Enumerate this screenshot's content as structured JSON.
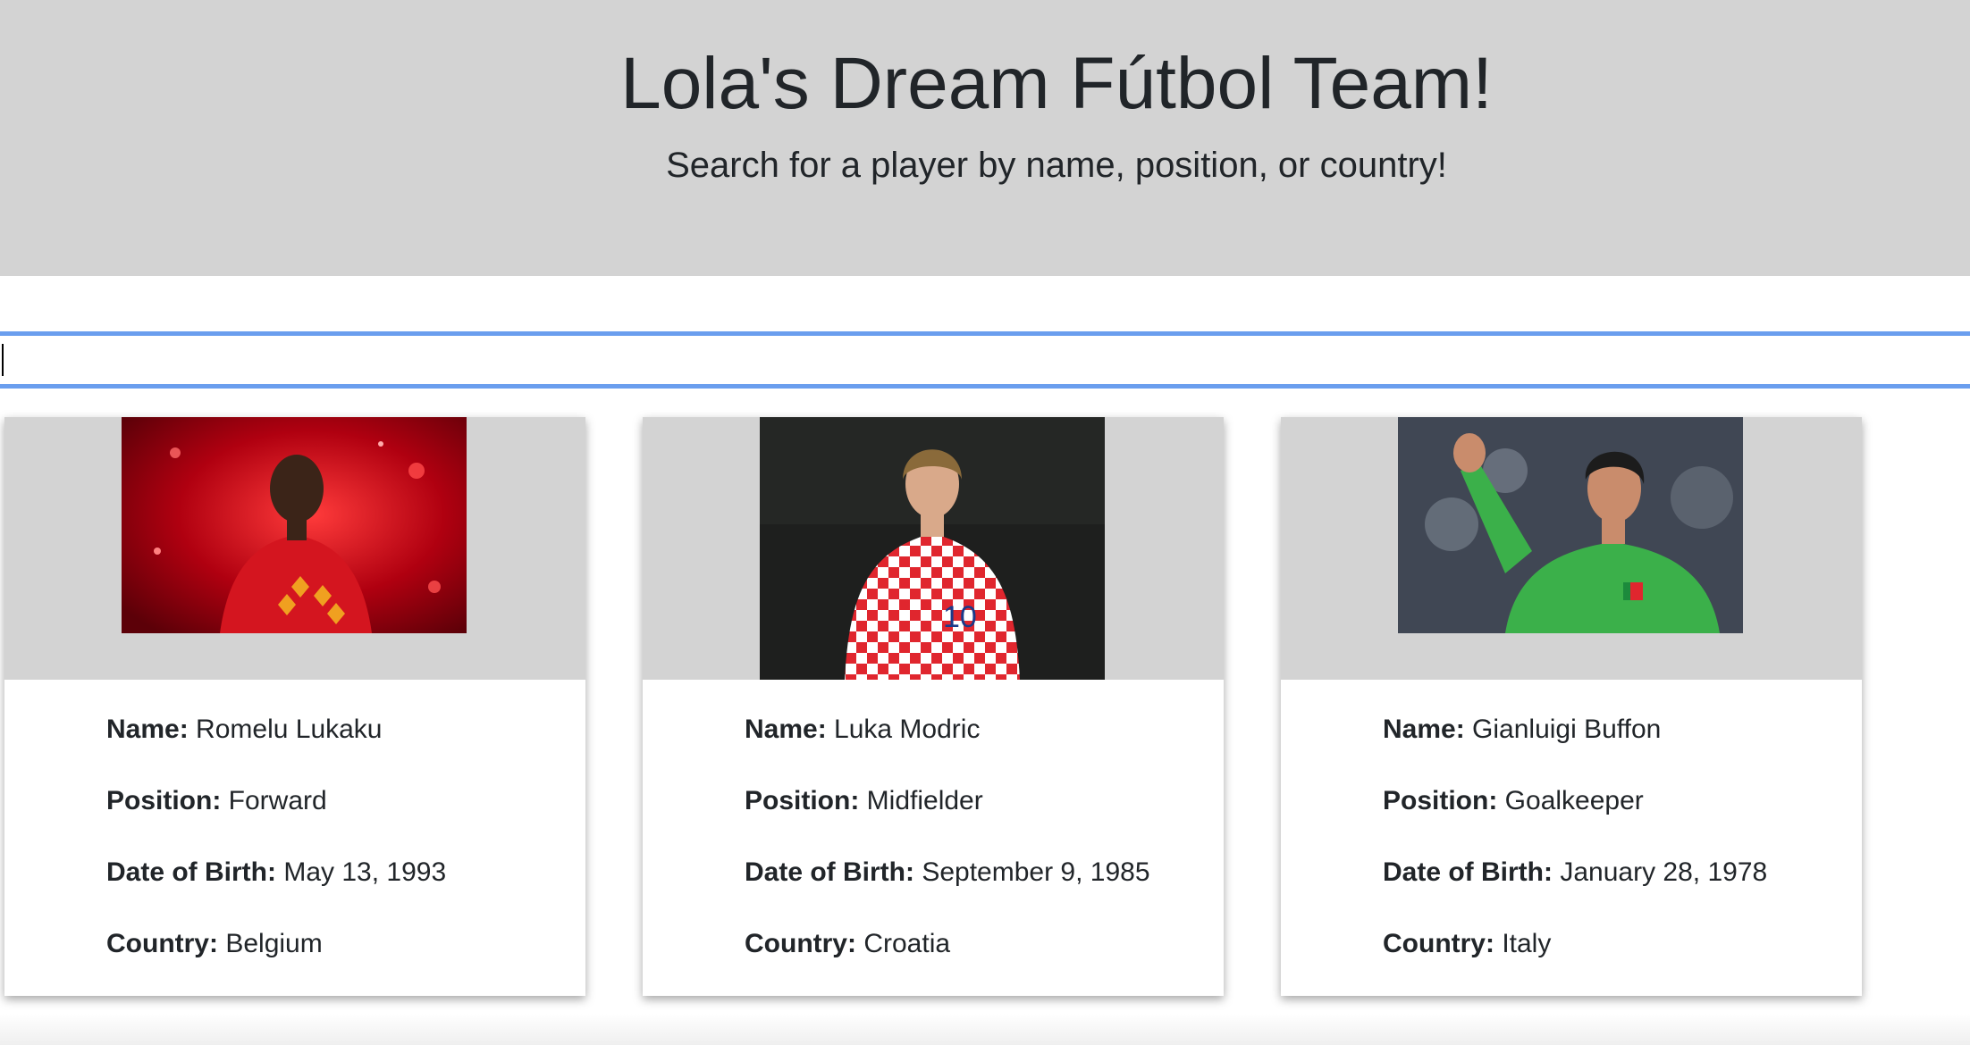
{
  "header": {
    "title": "Lola's Dream Fútbol Team!",
    "subtitle": "Search for a player by name, position, or country!",
    "background": "#d3d3d3"
  },
  "search": {
    "value": "",
    "placeholder": "",
    "focus_color": "#6a9eee"
  },
  "labels": {
    "name": "Name:",
    "position": "Position:",
    "dob": "Date of Birth:",
    "country": "Country:"
  },
  "players": [
    {
      "name": "Romelu Lukaku",
      "position": "Forward",
      "dob": "May 13, 1993",
      "country": "Belgium",
      "photo": "lukaku-photo"
    },
    {
      "name": "Luka Modric",
      "position": "Midfielder",
      "dob": "September 9, 1985",
      "country": "Croatia",
      "photo": "modric-photo"
    },
    {
      "name": "Gianluigi Buffon",
      "position": "Goalkeeper",
      "dob": "January 28, 1978",
      "country": "Italy",
      "photo": "buffon-photo"
    }
  ]
}
